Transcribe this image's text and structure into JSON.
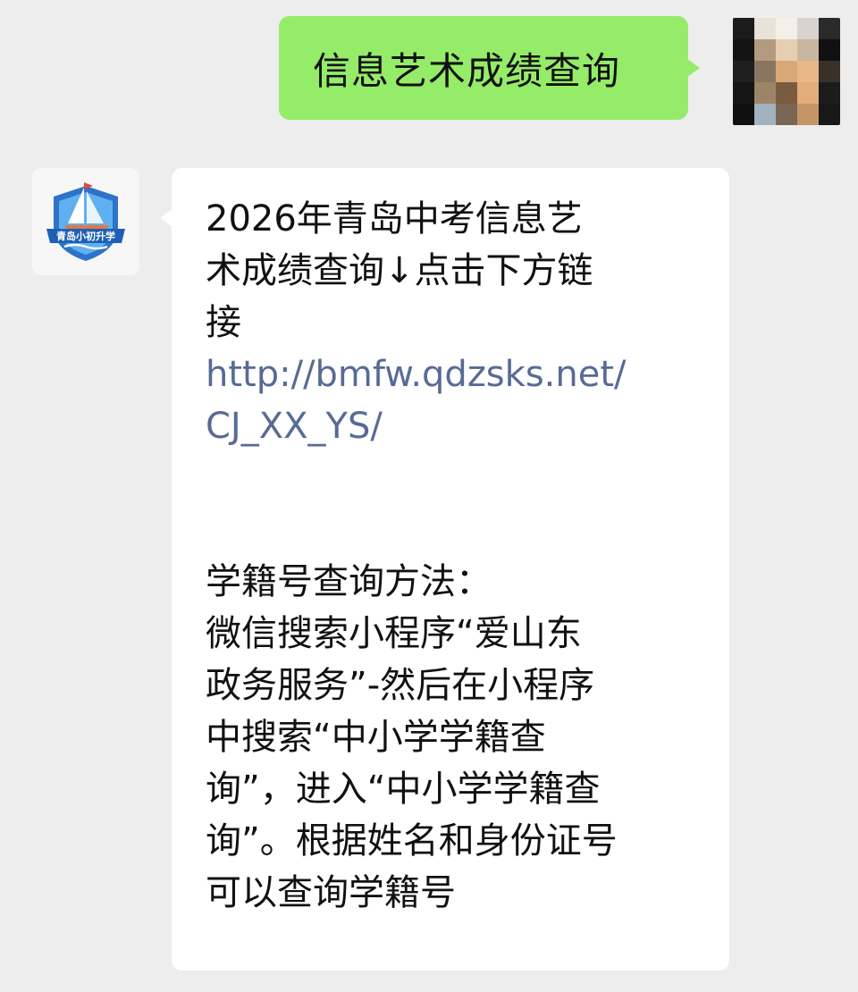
{
  "chat": {
    "outgoing": {
      "text": "信息艺术成绩查询"
    },
    "incoming": {
      "avatar_label": "青岛小初升学",
      "lines_top": [
        "2026年青岛中考信息艺",
        "术成绩查询↓点击下方链",
        "接"
      ],
      "link_lines": [
        "http://bmfw.qdzsks.net/",
        "CJ_XX_YS/"
      ],
      "lines_bottom": [
        "学籍号查询方法：",
        "微信搜索小程序“爱山东",
        "政务服务”-然后在小程序",
        "中搜索“中小学学籍查",
        "询”，进入“中小学学籍查",
        "询”。根据姓名和身份证号",
        "可以查询学籍号"
      ]
    }
  },
  "colors": {
    "background": "#ededed",
    "outgoing_bubble": "#95ec69",
    "incoming_bubble": "#ffffff",
    "link": "#576b95",
    "badge_blue": "#2f73c9",
    "badge_light": "#5fb0f0"
  },
  "icons": {
    "bot_avatar": "sailboat-shield-logo-icon",
    "user_avatar": "pixelated-photo-avatar"
  }
}
